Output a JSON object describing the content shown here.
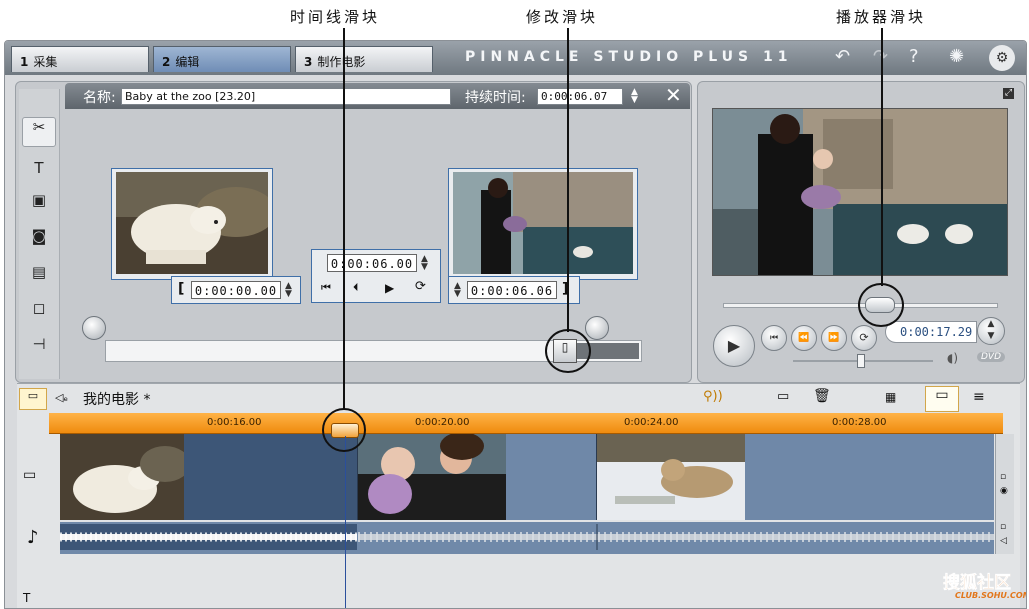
{
  "annotations": {
    "timeline_scrubber": "时间线滑块",
    "trim_scrubber": "修改滑块",
    "player_scrubber": "播放器滑块"
  },
  "app": {
    "brand": "PINNACLE STUDIO PLUS 11",
    "tabs": [
      {
        "num": "1",
        "label": "采集",
        "active": false
      },
      {
        "num": "2",
        "label": "编辑",
        "active": true
      },
      {
        "num": "3",
        "label": "制作电影",
        "active": false
      }
    ],
    "top_icons": [
      "undo-icon",
      "redo-icon",
      "help-icon",
      "tip-bulb-icon",
      "setup-icon"
    ]
  },
  "editor": {
    "name_label": "名称:",
    "name_value": "Baby at the zoo [23.20]",
    "duration_label": "持续时间:",
    "duration_value": "0:00:06.07",
    "tools": [
      "video-toolbox-icon",
      "title-icon",
      "photo-icon",
      "camera-icon",
      "clapper-icon",
      "frame-icon",
      "plug-icon"
    ],
    "mark_in": "0:00:00.00",
    "current": "0:00:06.00",
    "mark_out": "0:00:06.06"
  },
  "player": {
    "timecode": "0:00:17.29",
    "scrubber_position": 0.57,
    "volume_position": 0.48
  },
  "timeline": {
    "title": "我的电影 *",
    "ruler_ticks": [
      "0:00:16.00",
      "0:00:20.00",
      "0:00:24.00",
      "0:00:28.00"
    ],
    "clips": [
      "polar-bear-clip",
      "mother-baby-clip",
      "lioness-clip"
    ]
  },
  "watermark": {
    "text": "搜狐社区",
    "sub": "CLUB.SOHU.COM"
  }
}
